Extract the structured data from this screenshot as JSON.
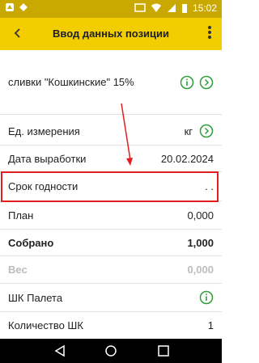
{
  "status": {
    "time": "15:02"
  },
  "header": {
    "title": "Ввод данных позиции"
  },
  "product": {
    "name": "сливки \"Кошкинские\" 15%"
  },
  "rows": [
    {
      "label": "Ед. измерения",
      "value": "кг"
    },
    {
      "label": "Дата выработки",
      "value": "20.02.2024"
    },
    {
      "label": "Срок годности",
      "value": ". ."
    },
    {
      "label": "План",
      "value": "0,000"
    },
    {
      "label": "Собрано",
      "value": "1,000"
    },
    {
      "label": "Вес",
      "value": "0,000"
    },
    {
      "label": "ШК Палета",
      "value": ""
    },
    {
      "label": "Количество ШК",
      "value": "1"
    }
  ],
  "colors": {
    "accent": "#f2cd00",
    "statusbar": "#c9a800",
    "icon_green": "#2e9e3a",
    "highlight": "#e02020"
  }
}
